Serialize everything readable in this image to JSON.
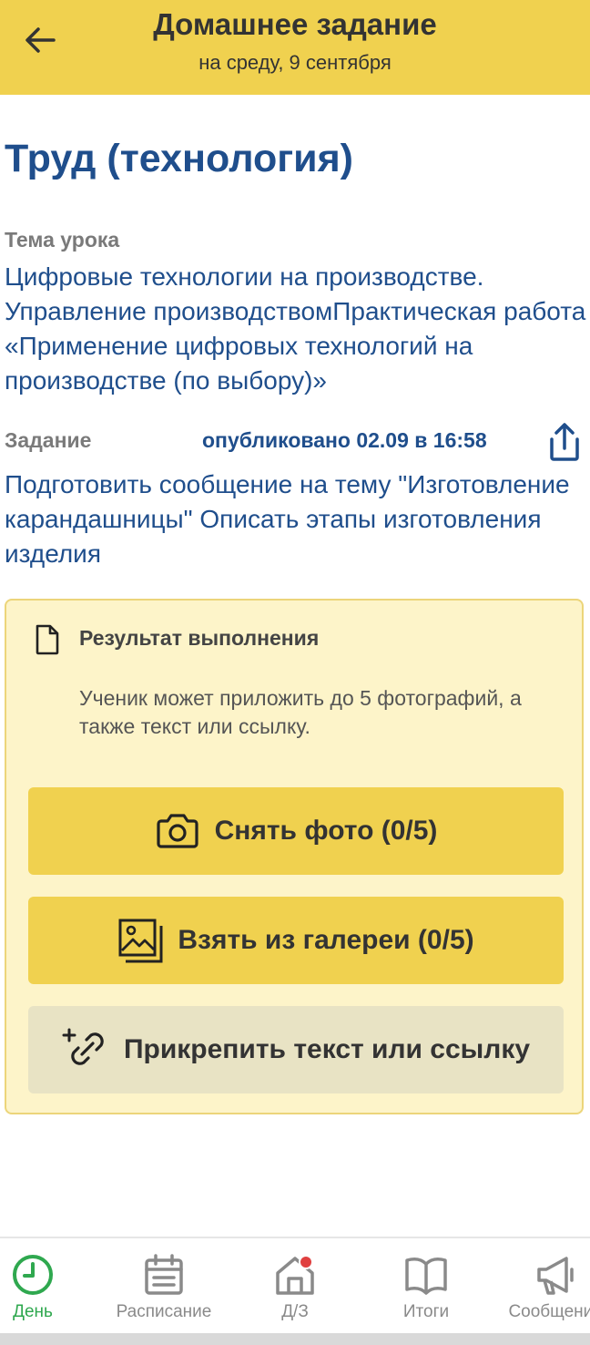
{
  "header": {
    "title": "Домашнее задание",
    "subtitle": "на среду, 9 сентября"
  },
  "subject": "Труд (технология)",
  "topic": {
    "label": "Тема урока",
    "text": "Цифровые технологии на производстве. Управление производствомПрактическая работа «Применение цифровых технологий на производстве (по выбору)»"
  },
  "task": {
    "label": "Задание",
    "published": "опубликовано 02.09 в 16:58",
    "text": "Подготовить сообщение на тему \"Изготовление карандашницы\" Описать этапы изготовления изделия"
  },
  "result": {
    "title": "Результат выполнения",
    "description": "Ученик может приложить до 5 фотографий, а также текст или ссылку.",
    "buttons": {
      "photo": "Снять фото (0/5)",
      "gallery": "Взять из галереи (0/5)",
      "attach": "Прикрепить текст или ссылку"
    }
  },
  "nav": {
    "items": [
      {
        "label": "День",
        "icon": "clock-icon"
      },
      {
        "label": "Расписание",
        "icon": "calendar-icon"
      },
      {
        "label": "Д/З",
        "icon": "home-icon"
      },
      {
        "label": "Итоги",
        "icon": "book-icon"
      },
      {
        "label": "Сообщения",
        "icon": "megaphone-icon"
      }
    ]
  },
  "colors": {
    "header_bg": "#f0d14f",
    "text_blue": "#1f4e8c",
    "active_green": "#2fa84f",
    "badge_red": "#e04040"
  }
}
